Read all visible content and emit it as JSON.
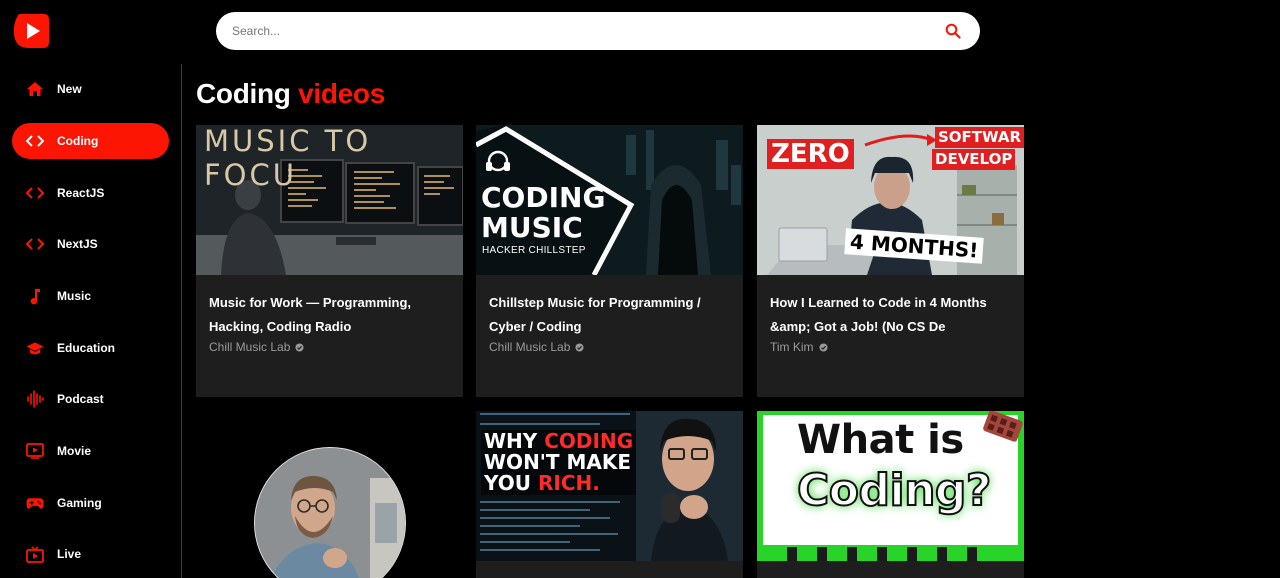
{
  "search": {
    "placeholder": "Search..."
  },
  "sidebar": {
    "items": [
      {
        "label": "New",
        "icon": "home-icon",
        "active": false
      },
      {
        "label": "Coding",
        "icon": "code-icon",
        "active": true
      },
      {
        "label": "ReactJS",
        "icon": "code-icon",
        "active": false
      },
      {
        "label": "NextJS",
        "icon": "code-icon",
        "active": false
      },
      {
        "label": "Music",
        "icon": "music-note-icon",
        "active": false
      },
      {
        "label": "Education",
        "icon": "graduation-cap-icon",
        "active": false
      },
      {
        "label": "Podcast",
        "icon": "podcast-icon",
        "active": false
      },
      {
        "label": "Movie",
        "icon": "movie-icon",
        "active": false
      },
      {
        "label": "Gaming",
        "icon": "gamepad-icon",
        "active": false
      },
      {
        "label": "Live",
        "icon": "live-tv-icon",
        "active": false
      }
    ]
  },
  "main": {
    "title_prefix": "Coding",
    "title_accent": "videos",
    "videos": [
      {
        "title_line1": "Music for Work — Programming,",
        "title_line2": "Hacking, Coding Radio",
        "channel": "Chill Music Lab",
        "thumb_text": "MUSIC TO FOCU"
      },
      {
        "title_line1": "Chillstep Music for Programming /",
        "title_line2": "Cyber / Coding",
        "channel": "Chill Music Lab",
        "thumb_text_1": "CODING",
        "thumb_text_2": "MUSIC",
        "thumb_text_3": "HACKER CHILLSTEP"
      },
      {
        "title_line1": "How I Learned to Code in 4 Months",
        "title_line2": "&amp; Got a Job! (No CS De",
        "channel": "Tim Kim",
        "thumb_text_1": "ZERO",
        "thumb_text_2": "SOFTWAR",
        "thumb_text_3": "DEVELOP",
        "thumb_text_4": "4 MONTHS!"
      },
      {
        "thumb_text_1": "WHY",
        "thumb_text_2": "CODING",
        "thumb_text_3": "WON'T MAKE",
        "thumb_text_4": "YOU",
        "thumb_text_5": "RICH."
      },
      {
        "thumb_text_1": "What is",
        "thumb_text_2": "Coding?"
      }
    ]
  },
  "colors": {
    "accent": "#fc1503",
    "card_bg": "#1e1e1e",
    "page_bg": "#000000"
  }
}
